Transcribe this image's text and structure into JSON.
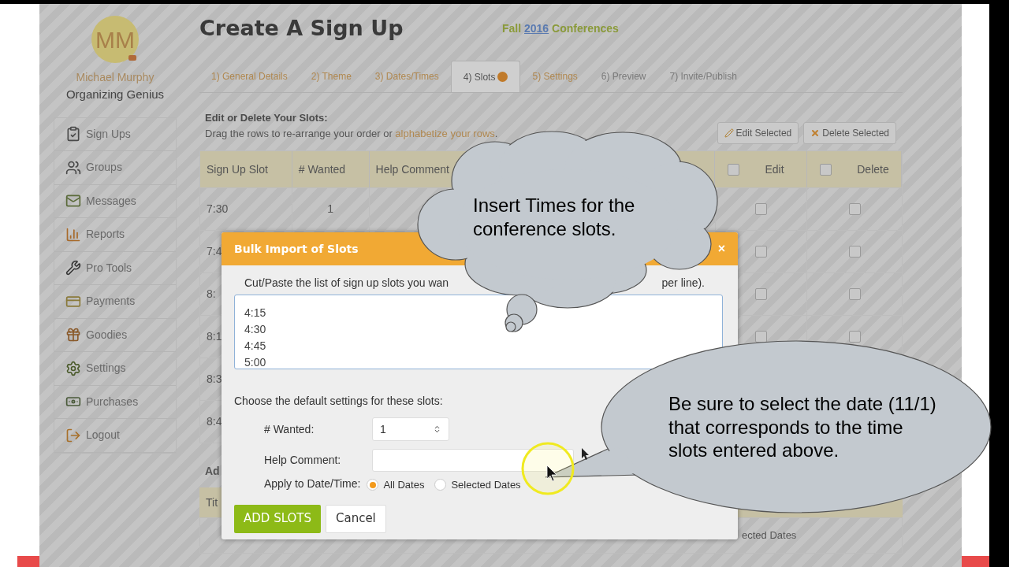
{
  "sidebar": {
    "avatar_initials": "MM",
    "name": "Michael Murphy",
    "role": "Organizing Genius",
    "items": [
      {
        "label": "Sign Ups"
      },
      {
        "label": "Groups"
      },
      {
        "label": "Messages"
      },
      {
        "label": "Reports"
      },
      {
        "label": "Pro Tools"
      },
      {
        "label": "Payments"
      },
      {
        "label": "Goodies"
      },
      {
        "label": "Settings"
      },
      {
        "label": "Purchases"
      },
      {
        "label": "Logout"
      }
    ]
  },
  "header": {
    "title": "Create A Sign Up",
    "event_before": "Fall",
    "event_year": "2016",
    "event_after": "Conferences"
  },
  "tabs": [
    {
      "label": "1) General Details",
      "selected": false,
      "visited": true
    },
    {
      "label": "2) Theme",
      "selected": false,
      "visited": true
    },
    {
      "label": "3) Dates/Times",
      "selected": false,
      "visited": true
    },
    {
      "label": "4) Slots",
      "selected": true,
      "visited": true
    },
    {
      "label": "5) Settings",
      "selected": false,
      "visited": true
    },
    {
      "label": "6) Preview",
      "selected": false,
      "visited": false
    },
    {
      "label": "7) Invite/Publish",
      "selected": false,
      "visited": false
    }
  ],
  "slots_section": {
    "heading": "Edit or Delete Your Slots:",
    "description": "Drag the rows to re-arrange your order or",
    "link": "alphabetize your rows",
    "link_after": ".",
    "buttons": [
      {
        "label": "Edit Selected",
        "kind": "edit"
      },
      {
        "label": "Delete Selected",
        "kind": "delete"
      }
    ]
  },
  "slots_table": {
    "columns": [
      {
        "label": "Sign Up Slot"
      },
      {
        "label": "# Wanted"
      },
      {
        "label": "Help Comment"
      },
      {
        "label": "Edit",
        "checked": false
      },
      {
        "label": "Delete",
        "checked": false
      }
    ],
    "rows": [
      {
        "slot": "7:30",
        "wanted": "1",
        "edit_checked": false,
        "delete_checked": false
      },
      {
        "slot": "7:4",
        "edit_checked": false,
        "delete_checked": false
      },
      {
        "slot": "8:",
        "edit_checked": false,
        "delete_checked": false
      },
      {
        "slot": "8:1",
        "edit_checked": false,
        "delete_checked": false
      },
      {
        "slot": "8:3"
      },
      {
        "slot": "8:4"
      }
    ]
  },
  "add_section": {
    "heading": "Ad",
    "table_header": "Tit",
    "cell": "ected Dates"
  },
  "modal": {
    "title": "Bulk Import of Slots",
    "close": "×",
    "instruction_start": "Cut/Paste the list of sign up slots you wan",
    "instruction_end": "per line).",
    "slots_text": [
      "4:15",
      "4:30",
      "4:45",
      "5:00"
    ],
    "defaults_label": "Choose the default settings for these slots:",
    "wanted": {
      "label": "# Wanted:",
      "value": "1"
    },
    "help_comment": {
      "label": "Help Comment:"
    },
    "apply": {
      "label": "Apply to Date/Time:",
      "options": [
        {
          "label": "All Dates",
          "selected": true
        },
        {
          "label": "Selected Dates",
          "selected": false
        }
      ]
    },
    "buttons": [
      {
        "label": "ADD SLOTS",
        "kind": "primary"
      },
      {
        "label": "Cancel",
        "kind": "secondary"
      }
    ]
  },
  "callouts": [
    {
      "kind": "thought",
      "text": "Insert Times for the conference slots."
    },
    {
      "kind": "speech",
      "text": "Be sure to select the date (11/1) that corresponds to the time slots entered above."
    }
  ]
}
